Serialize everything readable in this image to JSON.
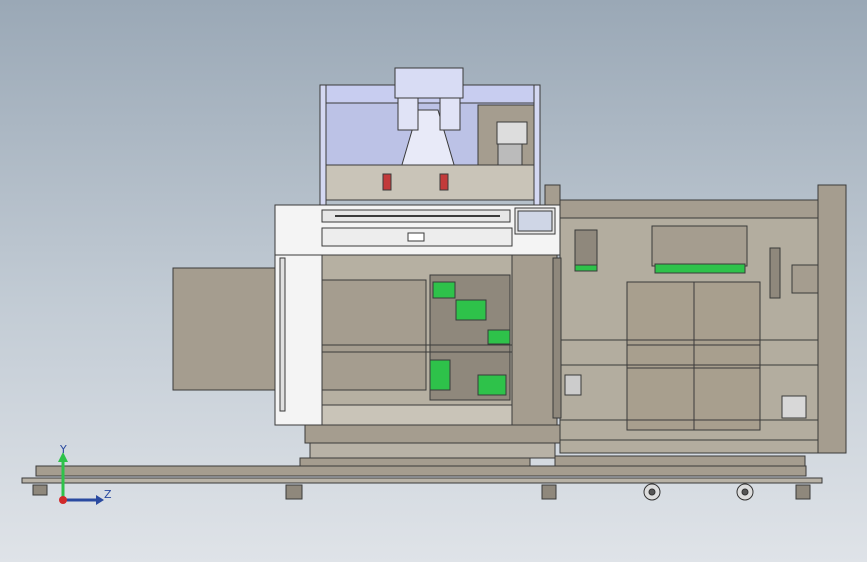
{
  "viewport": {
    "colors": {
      "background_top": "#9aa8b6",
      "background_bottom": "#dfe3e8",
      "frame_metal": "#a59d8f",
      "panel_white": "#f4f4f4",
      "green_parts": "#2ec24a",
      "blue_frame": "#c8cdf0",
      "edge_line": "#3a3a3a"
    }
  },
  "triad": {
    "y_label": "Y",
    "z_label": "Z",
    "icon": "coordinate-triad-icon"
  }
}
